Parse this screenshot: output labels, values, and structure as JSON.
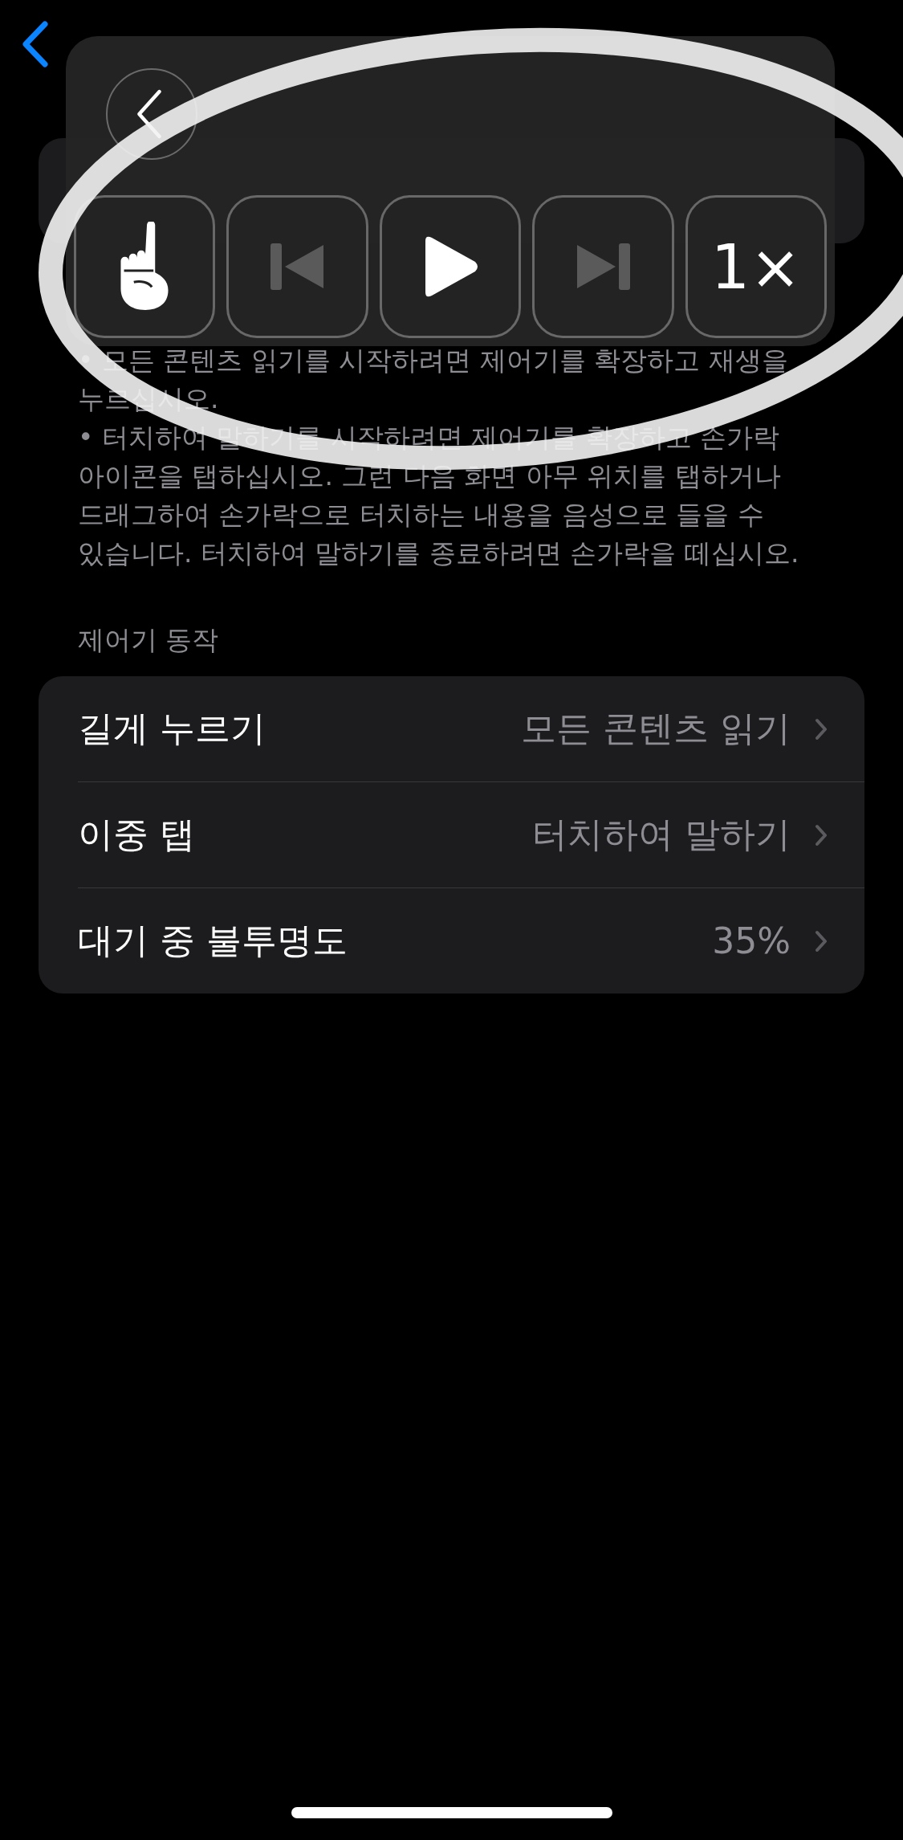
{
  "controller": {
    "buttons": [
      {
        "kind": "finger",
        "disabled": false
      },
      {
        "kind": "previous",
        "disabled": true
      },
      {
        "kind": "play",
        "disabled": false
      },
      {
        "kind": "next",
        "disabled": true
      },
      {
        "kind": "speed",
        "label": "1×"
      }
    ]
  },
  "description": [
    "• 모든 콘텐츠 읽기를 시작하려면 제어기를 확장하고 재생을 누르십시오.",
    "• 터치하여 말하기를 시작하려면 제어기를 확장하고 손가락 아이콘을 탭하십시오. 그런 다음 화면 아무 위치를 탭하거나 드래그하여 손가락으로 터치하는 내용을 음성으로 들을 수 있습니다. 터치하여 말하기를 종료하려면 손가락을 떼십시오."
  ],
  "section_header": "제어기 동작",
  "rows": [
    {
      "label": "길게 누르기",
      "value": "모든 콘텐츠 읽기"
    },
    {
      "label": "이중 탭",
      "value": "터치하여 말하기"
    },
    {
      "label": "대기 중 불투명도",
      "value": "35%"
    }
  ]
}
